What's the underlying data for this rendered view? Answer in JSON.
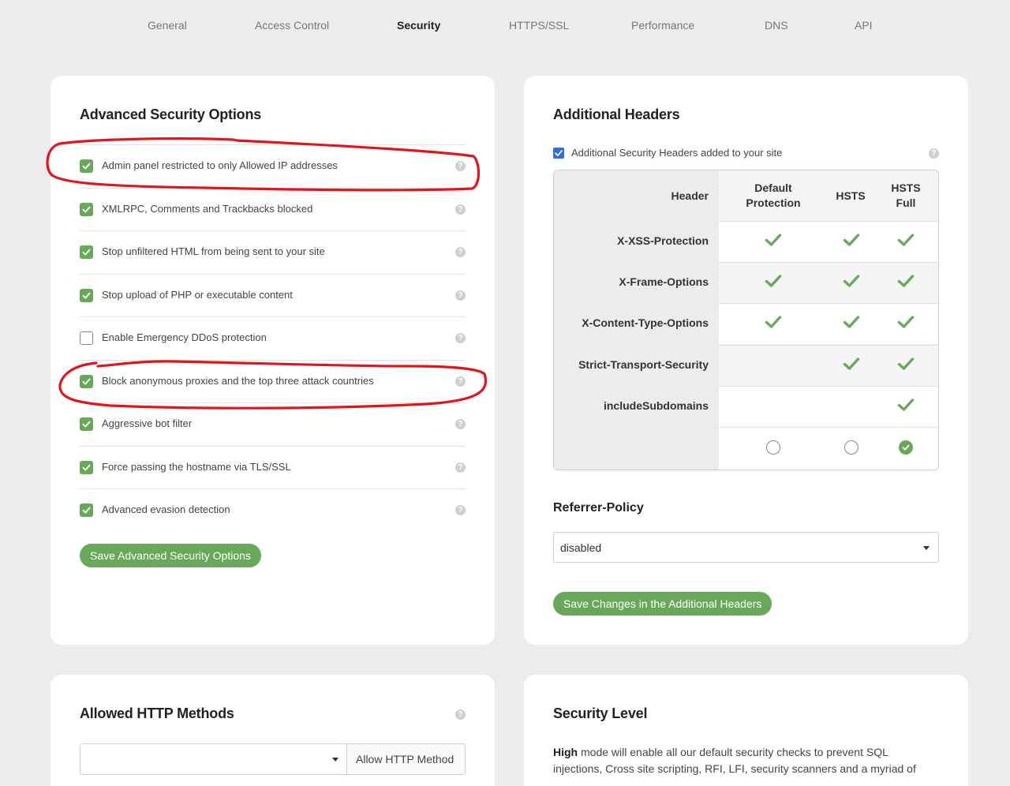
{
  "nav": {
    "tabs": [
      {
        "label": "General"
      },
      {
        "label": "Access Control"
      },
      {
        "label": "Security"
      },
      {
        "label": "HTTPS/SSL"
      },
      {
        "label": "Performance"
      },
      {
        "label": "DNS"
      },
      {
        "label": "API"
      }
    ],
    "active": "Security"
  },
  "advanced_security": {
    "title": "Advanced Security Options",
    "options": [
      {
        "label": "Admin panel restricted to only Allowed IP addresses",
        "checked": true
      },
      {
        "label": "XMLRPC, Comments and Trackbacks blocked",
        "checked": true
      },
      {
        "label": "Stop unfiltered HTML from being sent to your site",
        "checked": true
      },
      {
        "label": "Stop upload of PHP or executable content",
        "checked": true
      },
      {
        "label": "Enable Emergency DDoS protection",
        "checked": false
      },
      {
        "label": "Block anonymous proxies and the top three attack countries",
        "checked": true
      },
      {
        "label": "Aggressive bot filter",
        "checked": true
      },
      {
        "label": "Force passing the hostname via TLS/SSL",
        "checked": true
      },
      {
        "label": "Advanced evasion detection",
        "checked": true
      }
    ],
    "help_glyph": "?",
    "save_label": "Save Advanced Security Options"
  },
  "additional_headers": {
    "title": "Additional Headers",
    "enable_label": "Additional Security Headers added to your site",
    "enabled": true,
    "help_glyph": "?",
    "table": {
      "col_header": "Header",
      "col_default": [
        "Default",
        "Protection"
      ],
      "col_hsts": "HSTS",
      "col_hsts_full": [
        "HSTS",
        "Full"
      ],
      "rows": [
        {
          "name": "X-XSS-Protection",
          "default": true,
          "hsts": true,
          "full": true
        },
        {
          "name": "X-Frame-Options",
          "default": true,
          "hsts": true,
          "full": true
        },
        {
          "name": "X-Content-Type-Options",
          "default": true,
          "hsts": true,
          "full": true
        },
        {
          "name": "Strict-Transport-Security",
          "default": false,
          "hsts": true,
          "full": true
        },
        {
          "name": "includeSubdomains",
          "default": false,
          "hsts": false,
          "full": true
        }
      ],
      "selected_profile": "HSTS Full"
    },
    "referrer_policy": {
      "label": "Referrer-Policy",
      "value": "disabled"
    },
    "save_label": "Save Changes in the Additional Headers"
  },
  "http_methods": {
    "title": "Allowed HTTP Methods",
    "help_glyph": "?",
    "select_value": "",
    "button_label": "Allow HTTP Method"
  },
  "security_level": {
    "title": "Security Level",
    "mode": "High",
    "description": " mode will enable all our default security checks to prevent SQL injections, Cross site scripting, RFI, LFI, security scanners and a myriad of"
  },
  "colors": {
    "accent_green": "#69a85a",
    "checkbox_blue": "#2f6fdc",
    "annotation_red": "#e2141c"
  },
  "icons": {
    "check": "check-icon",
    "help": "question-circle-icon",
    "caret": "caret-down-icon"
  }
}
